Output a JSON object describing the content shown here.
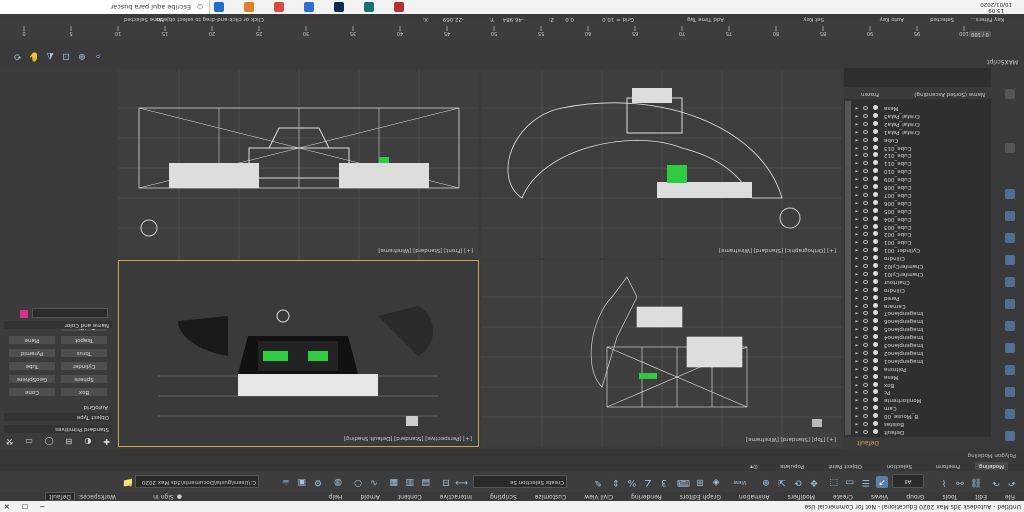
{
  "title": "Untitled - Autodesk 3ds Max 2020 Educational - Not for Commercial Use",
  "menus": [
    "File",
    "Edit",
    "Tools",
    "Group",
    "Views",
    "Create",
    "Modifiers",
    "Animation",
    "Graph Editors",
    "Rendering",
    "Civil View",
    "Customize",
    "Scripting",
    "Interactive",
    "Content",
    "Arnold",
    "Help"
  ],
  "sign_in": "Sign In",
  "workspaces_label": "Workspaces:",
  "workspace_value": "Default",
  "toolbar": {
    "selection_filter": "All",
    "create_selection_set": "Create Selection Se",
    "project_path": "C:\\Users\\gusta\\Documents\\3ds Max 2020"
  },
  "ribbon_tabs": [
    "Modeling",
    "Freeform",
    "Selection",
    "Object Paint",
    "Populate"
  ],
  "ribbon_panel": "Polygon Modeling",
  "scene_explorer": {
    "tab": "Default",
    "footer_sort": "Name (Sorted Ascending)",
    "footer_frozen": "Frozen",
    "items": [
      "Default",
      "Bolstas",
      "B_Mouse_00",
      "Cam",
      "Monitorfrente",
      "Pc",
      "Box",
      "Mesa",
      "Poltrona",
      "Imagenplano1",
      "Imagenplano2",
      "Imagenplano3",
      "Imagenplano4",
      "Imagenplano5",
      "Imagenplano6",
      "Imagenplano7",
      "Camara",
      "Pared",
      "Cilindro",
      "Chairtour",
      "ChamferCyl01",
      "ChamferCyl02",
      "Cilindro",
      "Cylinder_001",
      "Cube_001",
      "Cube_002",
      "Cube_003",
      "Cube_004",
      "Cube_005",
      "Cube_006",
      "Cube_007",
      "Cube_008",
      "Cube_009",
      "Cube_010",
      "Cube_011",
      "Cube_012",
      "Cube_013",
      "Cube",
      "Cristal_Pata1",
      "Cristal_Pata2",
      "Cristal_Pata3",
      "Mesa"
    ]
  },
  "viewports": [
    {
      "label": "[+] [Top] [Standard] [Wireframe]"
    },
    {
      "label": "[+] [Perspective] [Standard] [Default Shading]"
    },
    {
      "label": "[+] [Orthographic] [Standard] [Wireframe]"
    },
    {
      "label": "[+] [Front] [Standard] [Wireframe]"
    }
  ],
  "command_panel": {
    "object_type_header": "Object Type",
    "autogrid": "AutoGrid",
    "objects": [
      "Box",
      "Cone",
      "Sphere",
      "GeoSphere",
      "Cylinder",
      "Tube",
      "Torus",
      "Pyramid",
      "Teapot",
      "Plane",
      "TextPlus"
    ],
    "standard_primitives": "Standard Primitives",
    "name_color_header": "Name and Color"
  },
  "timeline": {
    "frame_label": "0 / 100",
    "ticks": [
      "0",
      "5",
      "10",
      "15",
      "20",
      "25",
      "30",
      "35",
      "40",
      "45",
      "50",
      "55",
      "60",
      "65",
      "70",
      "75",
      "80",
      "85",
      "90",
      "95",
      "100"
    ]
  },
  "status": {
    "prompt": "Click or click-and-drag to select objects",
    "selected": "None Selected",
    "x_label": "X:",
    "x": "-22.069",
    "y_label": "Y:",
    "y": "-46.984",
    "z_label": "Z:",
    "z": "0.0",
    "grid": "Grid = 10.0",
    "add_time_tag": "Add Time Tag",
    "auto_key": "Auto Key",
    "selected_btn": "Selected",
    "set_key": "Set Key",
    "key_filters": "Key Filters..."
  },
  "taskbar": {
    "search_placeholder": "Escribe aquí para buscar",
    "time": "13:09",
    "date": "10/01/2020"
  },
  "colors": {
    "accent": "#5a7fa7",
    "selection_green": "#2ecc40",
    "object_color": "#e02d8f"
  }
}
